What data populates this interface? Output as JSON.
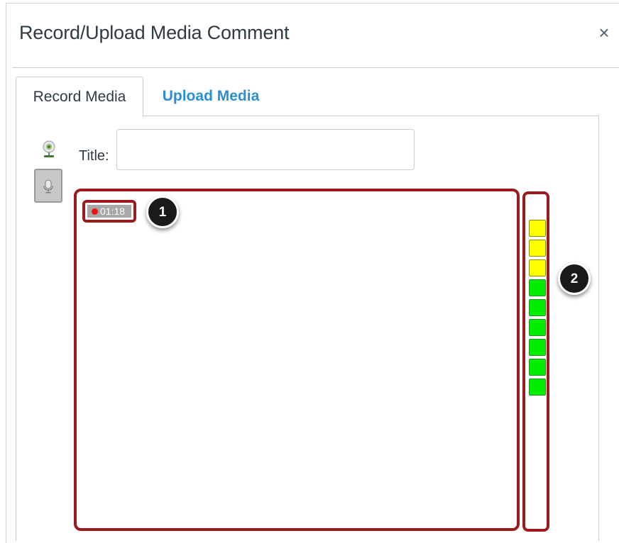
{
  "dialog": {
    "title": "Record/Upload Media Comment",
    "close_label": "×"
  },
  "tabs": [
    {
      "label": "Record Media",
      "active": true
    },
    {
      "label": "Upload Media",
      "active": false
    }
  ],
  "form": {
    "title_label": "Title:",
    "title_value": "",
    "title_placeholder": ""
  },
  "recorder": {
    "elapsed": "01:18",
    "recording_indicator_color": "#ee1111",
    "webcam_icon": "webcam-icon",
    "mic_icon": "microphone-icon"
  },
  "level_meter": {
    "segments": [
      "yellow",
      "yellow",
      "yellow",
      "green",
      "green",
      "green",
      "green",
      "green",
      "green"
    ],
    "colors": {
      "yellow": "#ffff00",
      "green": "#00ee00"
    }
  },
  "callouts": {
    "one": "1",
    "two": "2"
  },
  "colors": {
    "accent_link": "#2a8fd6",
    "highlight_border": "#9b1b1f",
    "text": "#2d3b45"
  }
}
